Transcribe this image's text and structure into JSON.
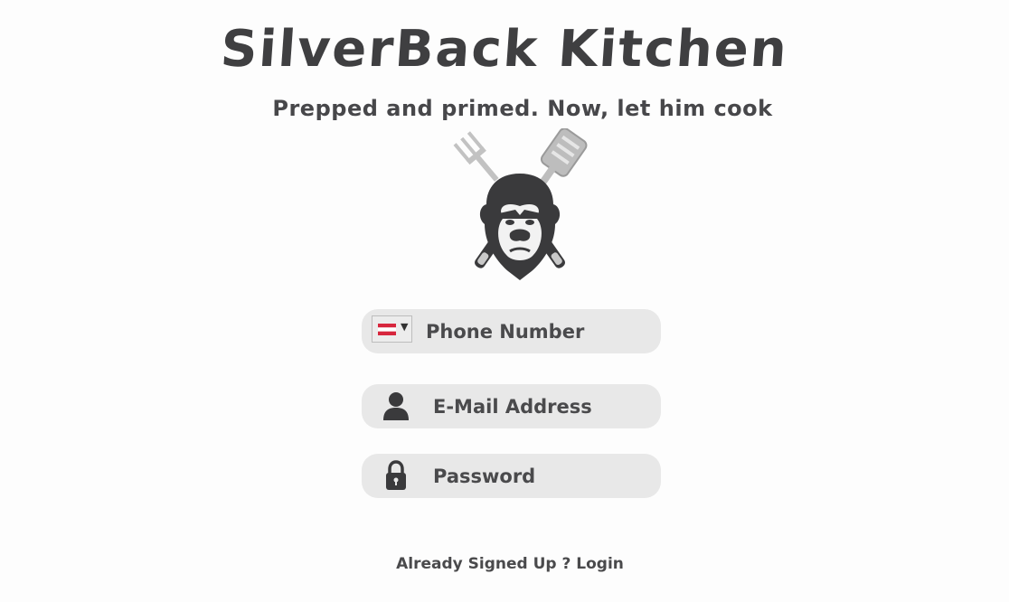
{
  "header": {
    "title": "SilverBack Kitchen",
    "subtitle": "Prepped and primed. Now, let him cook"
  },
  "logo": {
    "icon": "gorilla-chef-logo-icon"
  },
  "form": {
    "phone": {
      "placeholder": "Phone Number",
      "value": "",
      "country_flag": "austria-flag-icon",
      "flag_colors": [
        "#d7263d",
        "#ffffff",
        "#d7263d"
      ]
    },
    "email": {
      "placeholder": "E-Mail Address",
      "value": "",
      "icon": "user-icon"
    },
    "password": {
      "placeholder": "Password",
      "value": "",
      "icon": "lock-icon"
    }
  },
  "footer": {
    "prompt": "Already Signed Up ?",
    "login_label": "Login"
  },
  "colors": {
    "background": "#fdfdfd",
    "field_background": "#e8e8e8",
    "text": "#444444"
  }
}
